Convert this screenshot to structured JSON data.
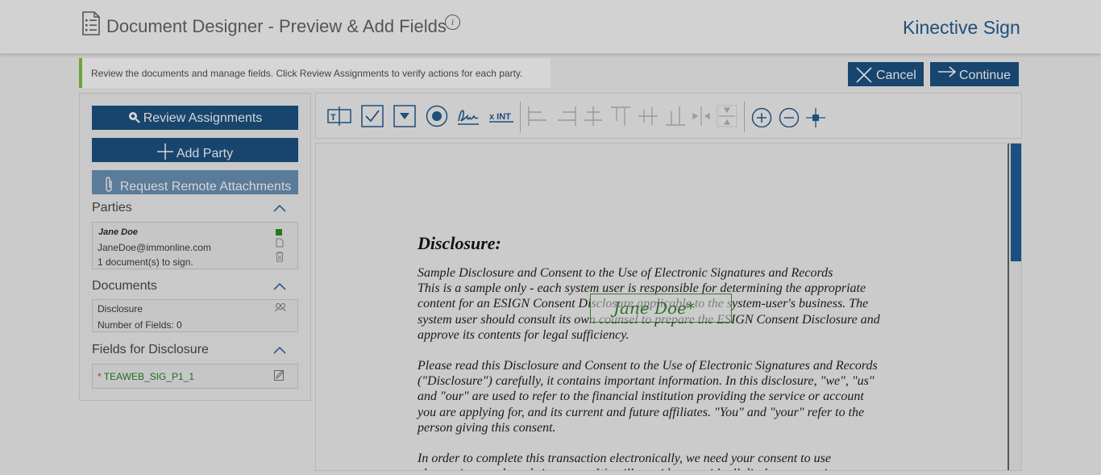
{
  "header": {
    "title": "Document Designer - Preview & Add Fields",
    "info_glyph": "i",
    "brand": "Kinective Sign"
  },
  "notice": "Review the documents and manage fields. Click Review Assignments to verify actions for each party.",
  "actions": {
    "cancel": "Cancel",
    "continue": "Continue"
  },
  "left": {
    "review_assignments": "Review Assignments",
    "add_party": "Add Party",
    "request_remote": "Request Remote Attachments",
    "parties_heading": "Parties",
    "party": {
      "name": "Jane Doe",
      "email": "JaneDoe@immonline.com",
      "status": "1 document(s) to sign.",
      "color": "#1f7a1f"
    },
    "documents_heading": "Documents",
    "document": {
      "name": "Disclosure",
      "fields": "Number of Fields: 0"
    },
    "fields_heading": "Fields for Disclosure",
    "field": {
      "required_mark": "*",
      "name": "TEAWEB_SIG_P1_1"
    }
  },
  "toolbar": {
    "tools": [
      "text-field-icon",
      "checkbox-icon",
      "dropdown-icon",
      "radio-icon",
      "signature-icon",
      "initials-icon"
    ],
    "initials_label": "x INT",
    "align": [
      "align-left-icon",
      "align-right-icon",
      "align-center-h-icon",
      "align-top-icon",
      "align-middle-icon",
      "align-bottom-icon",
      "distribute-h-icon",
      "distribute-v-icon"
    ],
    "zoom": [
      "zoom-in-icon",
      "zoom-out-icon",
      "move-icon"
    ]
  },
  "document": {
    "heading": "Disclosure:",
    "para1": "Sample Disclosure and Consent to the Use of Electronic Signatures and Records\nThis is a sample only - each system user is responsible for determining the appropriate\ncontent for an ESIGN Consent Disclosure applicable to the system-user's business. The\nsystem user should consult its own counsel to prepare the ESIGN Consent Disclosure and\napprove its contents for legal sufficiency.",
    "para2": "Please read this Disclosure and Consent to the Use of Electronic Signatures and Records\n(\"Disclosure\") carefully, it contains important information. In this disclosure, \"we\", \"us\"\nand \"our\" are used to refer to the financial institution providing the service or account\nyou are applying for, and its current and future affiliates. \"You\" and \"your\" refer to the\nperson giving this consent.",
    "para3": "In order to complete this transaction electronically, we need your consent to use\nelectronic records and signatures. We will provide you with all disclosures, notices,",
    "signature_field": "Jane Doe*"
  }
}
